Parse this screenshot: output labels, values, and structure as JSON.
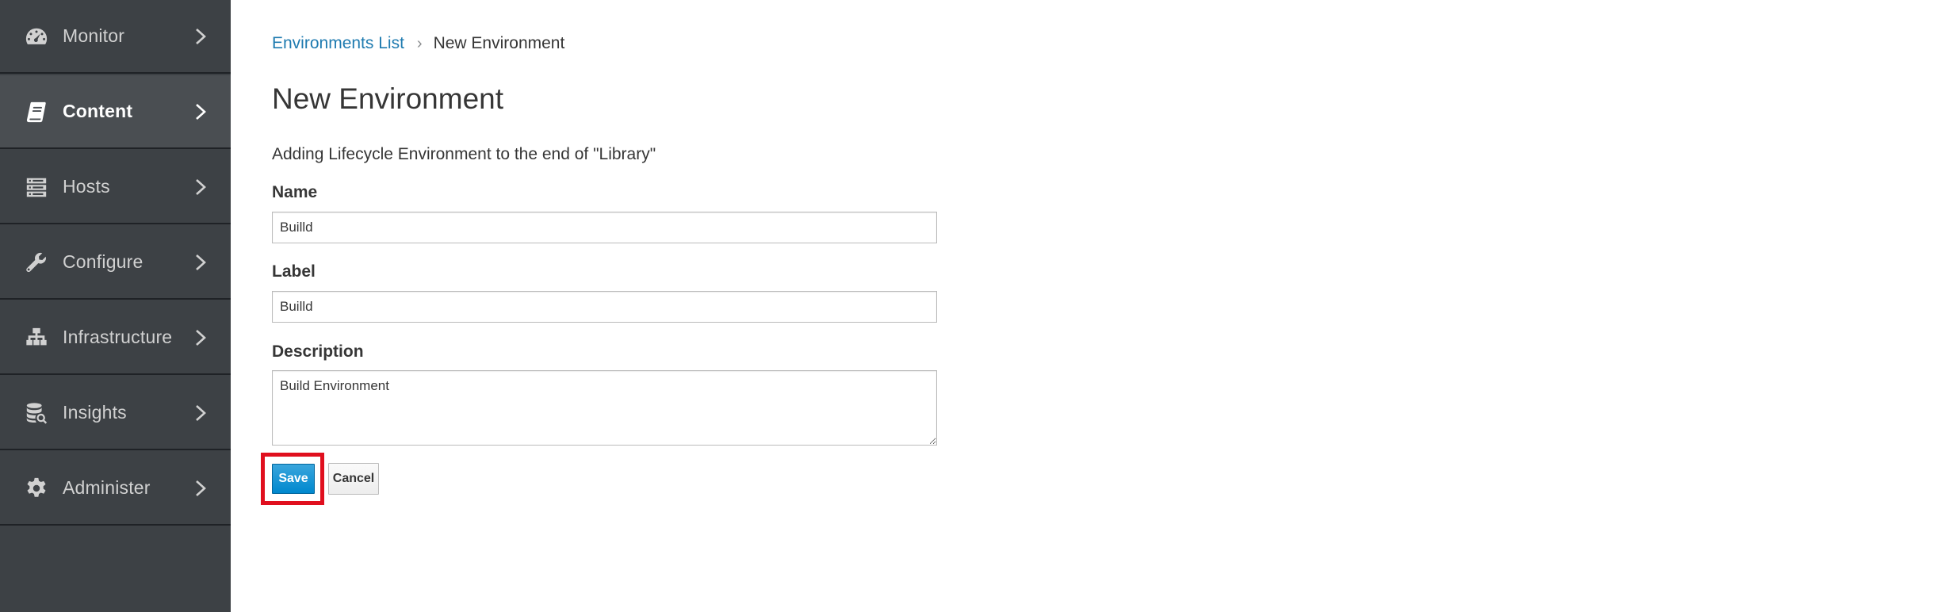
{
  "sidebar": {
    "items": [
      {
        "label": "Monitor",
        "icon": "dashboard-gauge-icon",
        "active": false
      },
      {
        "label": "Content",
        "icon": "book-icon",
        "active": true
      },
      {
        "label": "Hosts",
        "icon": "server-icon",
        "active": false
      },
      {
        "label": "Configure",
        "icon": "wrench-icon",
        "active": false
      },
      {
        "label": "Infrastructure",
        "icon": "network-icon",
        "active": false
      },
      {
        "label": "Insights",
        "icon": "database-search-icon",
        "active": false
      },
      {
        "label": "Administer",
        "icon": "gear-icon",
        "active": false
      }
    ]
  },
  "breadcrumb": {
    "link": "Environments List",
    "separator": "›",
    "current": "New Environment"
  },
  "page": {
    "title": "New Environment",
    "subtitle": "Adding Lifecycle Environment to the end of \"Library\""
  },
  "form": {
    "name_label": "Name",
    "name_value": "Builld",
    "label_label": "Label",
    "label_value": "Builld",
    "description_label": "Description",
    "description_value": "Build Environment",
    "save_label": "Save",
    "cancel_label": "Cancel"
  },
  "colors": {
    "sidebar_bg": "#3d4145",
    "link": "#1f7bb0",
    "primary_button": "#0088ce",
    "highlight": "#e00f1e"
  }
}
